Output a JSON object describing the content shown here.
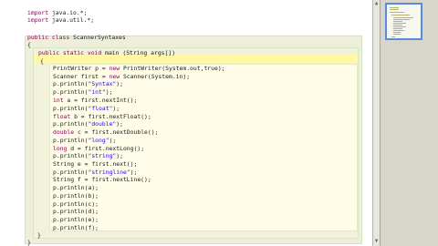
{
  "editor": {
    "lines": [
      {
        "pre": "",
        "kw": "import",
        "mid": " java.io.*;",
        "str": "",
        "post": ""
      },
      {
        "pre": "",
        "kw": "import",
        "mid": " java.util.*;",
        "str": "",
        "post": ""
      },
      {
        "pre": "",
        "kw": "public class",
        "mid": " ScannerSyntaxes",
        "str": "",
        "post": ""
      },
      {
        "pre": "{",
        "kw": "",
        "mid": "",
        "str": "",
        "post": ""
      },
      {
        "pre": "",
        "kw": "public static void",
        "mid": " main (String args[])",
        "str": "",
        "post": ""
      },
      {
        "pre": "{",
        "kw": "",
        "mid": "",
        "str": "",
        "post": ""
      },
      {
        "pre": "PrintWriter p = ",
        "kw": "new",
        "mid": " PrintWriter(System.out,",
        "str": "",
        "post": "true);"
      },
      {
        "pre": "Scanner first = ",
        "kw": "new",
        "mid": " Scanner(System.in);",
        "str": "",
        "post": ""
      },
      {
        "pre": "p.println(",
        "kw": "",
        "mid": "",
        "str": "\"Syntax\"",
        "post": ");"
      },
      {
        "pre": "p.println(",
        "kw": "",
        "mid": "",
        "str": "\"int\"",
        "post": ");"
      },
      {
        "pre": "",
        "kw": "int",
        "mid": " a = first.nextInt();",
        "str": "",
        "post": ""
      },
      {
        "pre": "p.println(",
        "kw": "",
        "mid": "",
        "str": "\"float\"",
        "post": ");"
      },
      {
        "pre": "",
        "kw": "float",
        "mid": " b = first.nextFloat();",
        "str": "",
        "post": ""
      },
      {
        "pre": "p.println(",
        "kw": "",
        "mid": "",
        "str": "\"double\"",
        "post": ");"
      },
      {
        "pre": "",
        "kw": "double",
        "mid": " c = first.nextDouble();",
        "str": "",
        "post": ""
      },
      {
        "pre": "p.println(",
        "kw": "",
        "mid": "",
        "str": "\"long\"",
        "post": ");"
      },
      {
        "pre": "",
        "kw": "long",
        "mid": " d = first.nextLong();",
        "str": "",
        "post": ""
      },
      {
        "pre": "p.println(",
        "kw": "",
        "mid": "",
        "str": "\"string\"",
        "post": ");"
      },
      {
        "pre": "String e = first.next();",
        "kw": "",
        "mid": "",
        "str": "",
        "post": ""
      },
      {
        "pre": "p.println(",
        "kw": "",
        "mid": "",
        "str": "\"stringline\"",
        "post": ");"
      },
      {
        "pre": "String f = first.nextLine();",
        "kw": "",
        "mid": "",
        "str": "",
        "post": ""
      },
      {
        "pre": "p.println(a);",
        "kw": "",
        "mid": "",
        "str": "",
        "post": ""
      },
      {
        "pre": "p.println(b);",
        "kw": "",
        "mid": "",
        "str": "",
        "post": ""
      },
      {
        "pre": "p.println(c);",
        "kw": "",
        "mid": "",
        "str": "",
        "post": ""
      },
      {
        "pre": "p.println(d);",
        "kw": "",
        "mid": "",
        "str": "",
        "post": ""
      },
      {
        "pre": "p.println(e);",
        "kw": "",
        "mid": "",
        "str": "",
        "post": ""
      },
      {
        "pre": "p.println(f);",
        "kw": "",
        "mid": "",
        "str": "",
        "post": ""
      },
      {
        "pre": "}",
        "kw": "",
        "mid": "",
        "str": "",
        "post": ""
      },
      {
        "pre": "}",
        "kw": "",
        "mid": "",
        "str": "",
        "post": ""
      }
    ]
  },
  "gutter": {
    "scroll_up_icon": "▲",
    "scroll_down_icon": "▼"
  },
  "colors": {
    "keyword": "#7f0055",
    "string": "#2a00ff",
    "class_scope": "#efeed8",
    "method_scope": "#f2f1dc",
    "body_scope": "#fffde8",
    "caret_line": "#fff9a6",
    "thumbnail_border": "#5b8bd6"
  }
}
